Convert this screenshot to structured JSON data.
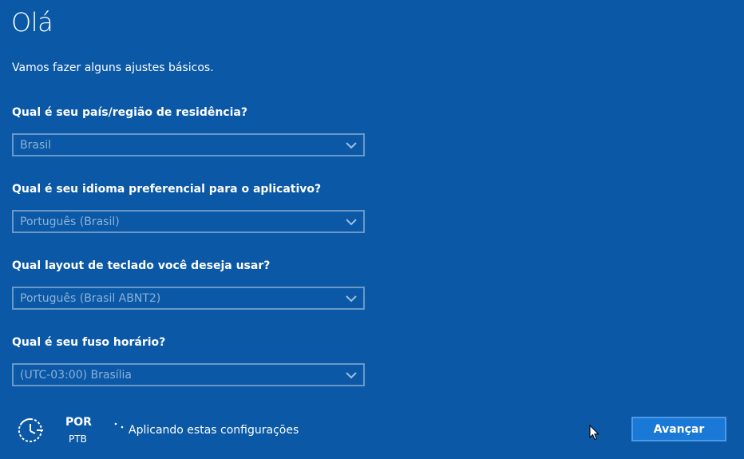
{
  "header": {
    "title": "Olá",
    "subtitle": "Vamos fazer alguns ajustes básicos."
  },
  "fields": [
    {
      "label": "Qual é seu país/região de residência?",
      "value": "Brasil"
    },
    {
      "label": "Qual é seu idioma preferencial para o aplicativo?",
      "value": "Português (Brasil)"
    },
    {
      "label": "Qual layout de teclado você deseja usar?",
      "value": "Português (Brasil ABNT2)"
    },
    {
      "label": "Qual é seu fuso horário?",
      "value": "(UTC-03:00) Brasília"
    }
  ],
  "footer": {
    "icon": "accessibility-icon",
    "language_code": "POR",
    "language_sub": "PTB",
    "status_icon": "spinner-icon",
    "status_text": "Aplicando estas configurações",
    "next_label": "Avançar"
  },
  "colors": {
    "background": "#0a58a6",
    "field_border": "#6b98c8",
    "field_text": "#8eb2d8",
    "button_bg": "#1a78d7",
    "button_border": "#4e9ae6"
  }
}
